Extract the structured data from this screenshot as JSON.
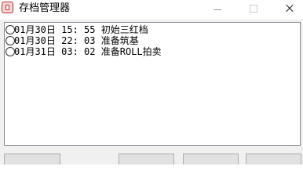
{
  "window": {
    "title": "存档管理器",
    "icon": "app-icon",
    "controls": {
      "minimize_icon": "minimize-icon",
      "maximize_icon": "maximize-icon",
      "close_icon": "close-icon"
    }
  },
  "saves": [
    {
      "date": "01月30日",
      "time": "15: 55",
      "name": "初始三红档",
      "selected": false
    },
    {
      "date": "01月30日",
      "time": "22: 03",
      "name": "准备筑基",
      "selected": false
    },
    {
      "date": "01月31日",
      "time": "03: 02",
      "name": "准备ROLL拍卖",
      "selected": false
    }
  ],
  "colors": {
    "window_background": "#f0f0f0",
    "list_border": "#828790",
    "button_face": "#e1e1e1",
    "button_border": "#adadad",
    "icon_accent": "#b8302a"
  }
}
